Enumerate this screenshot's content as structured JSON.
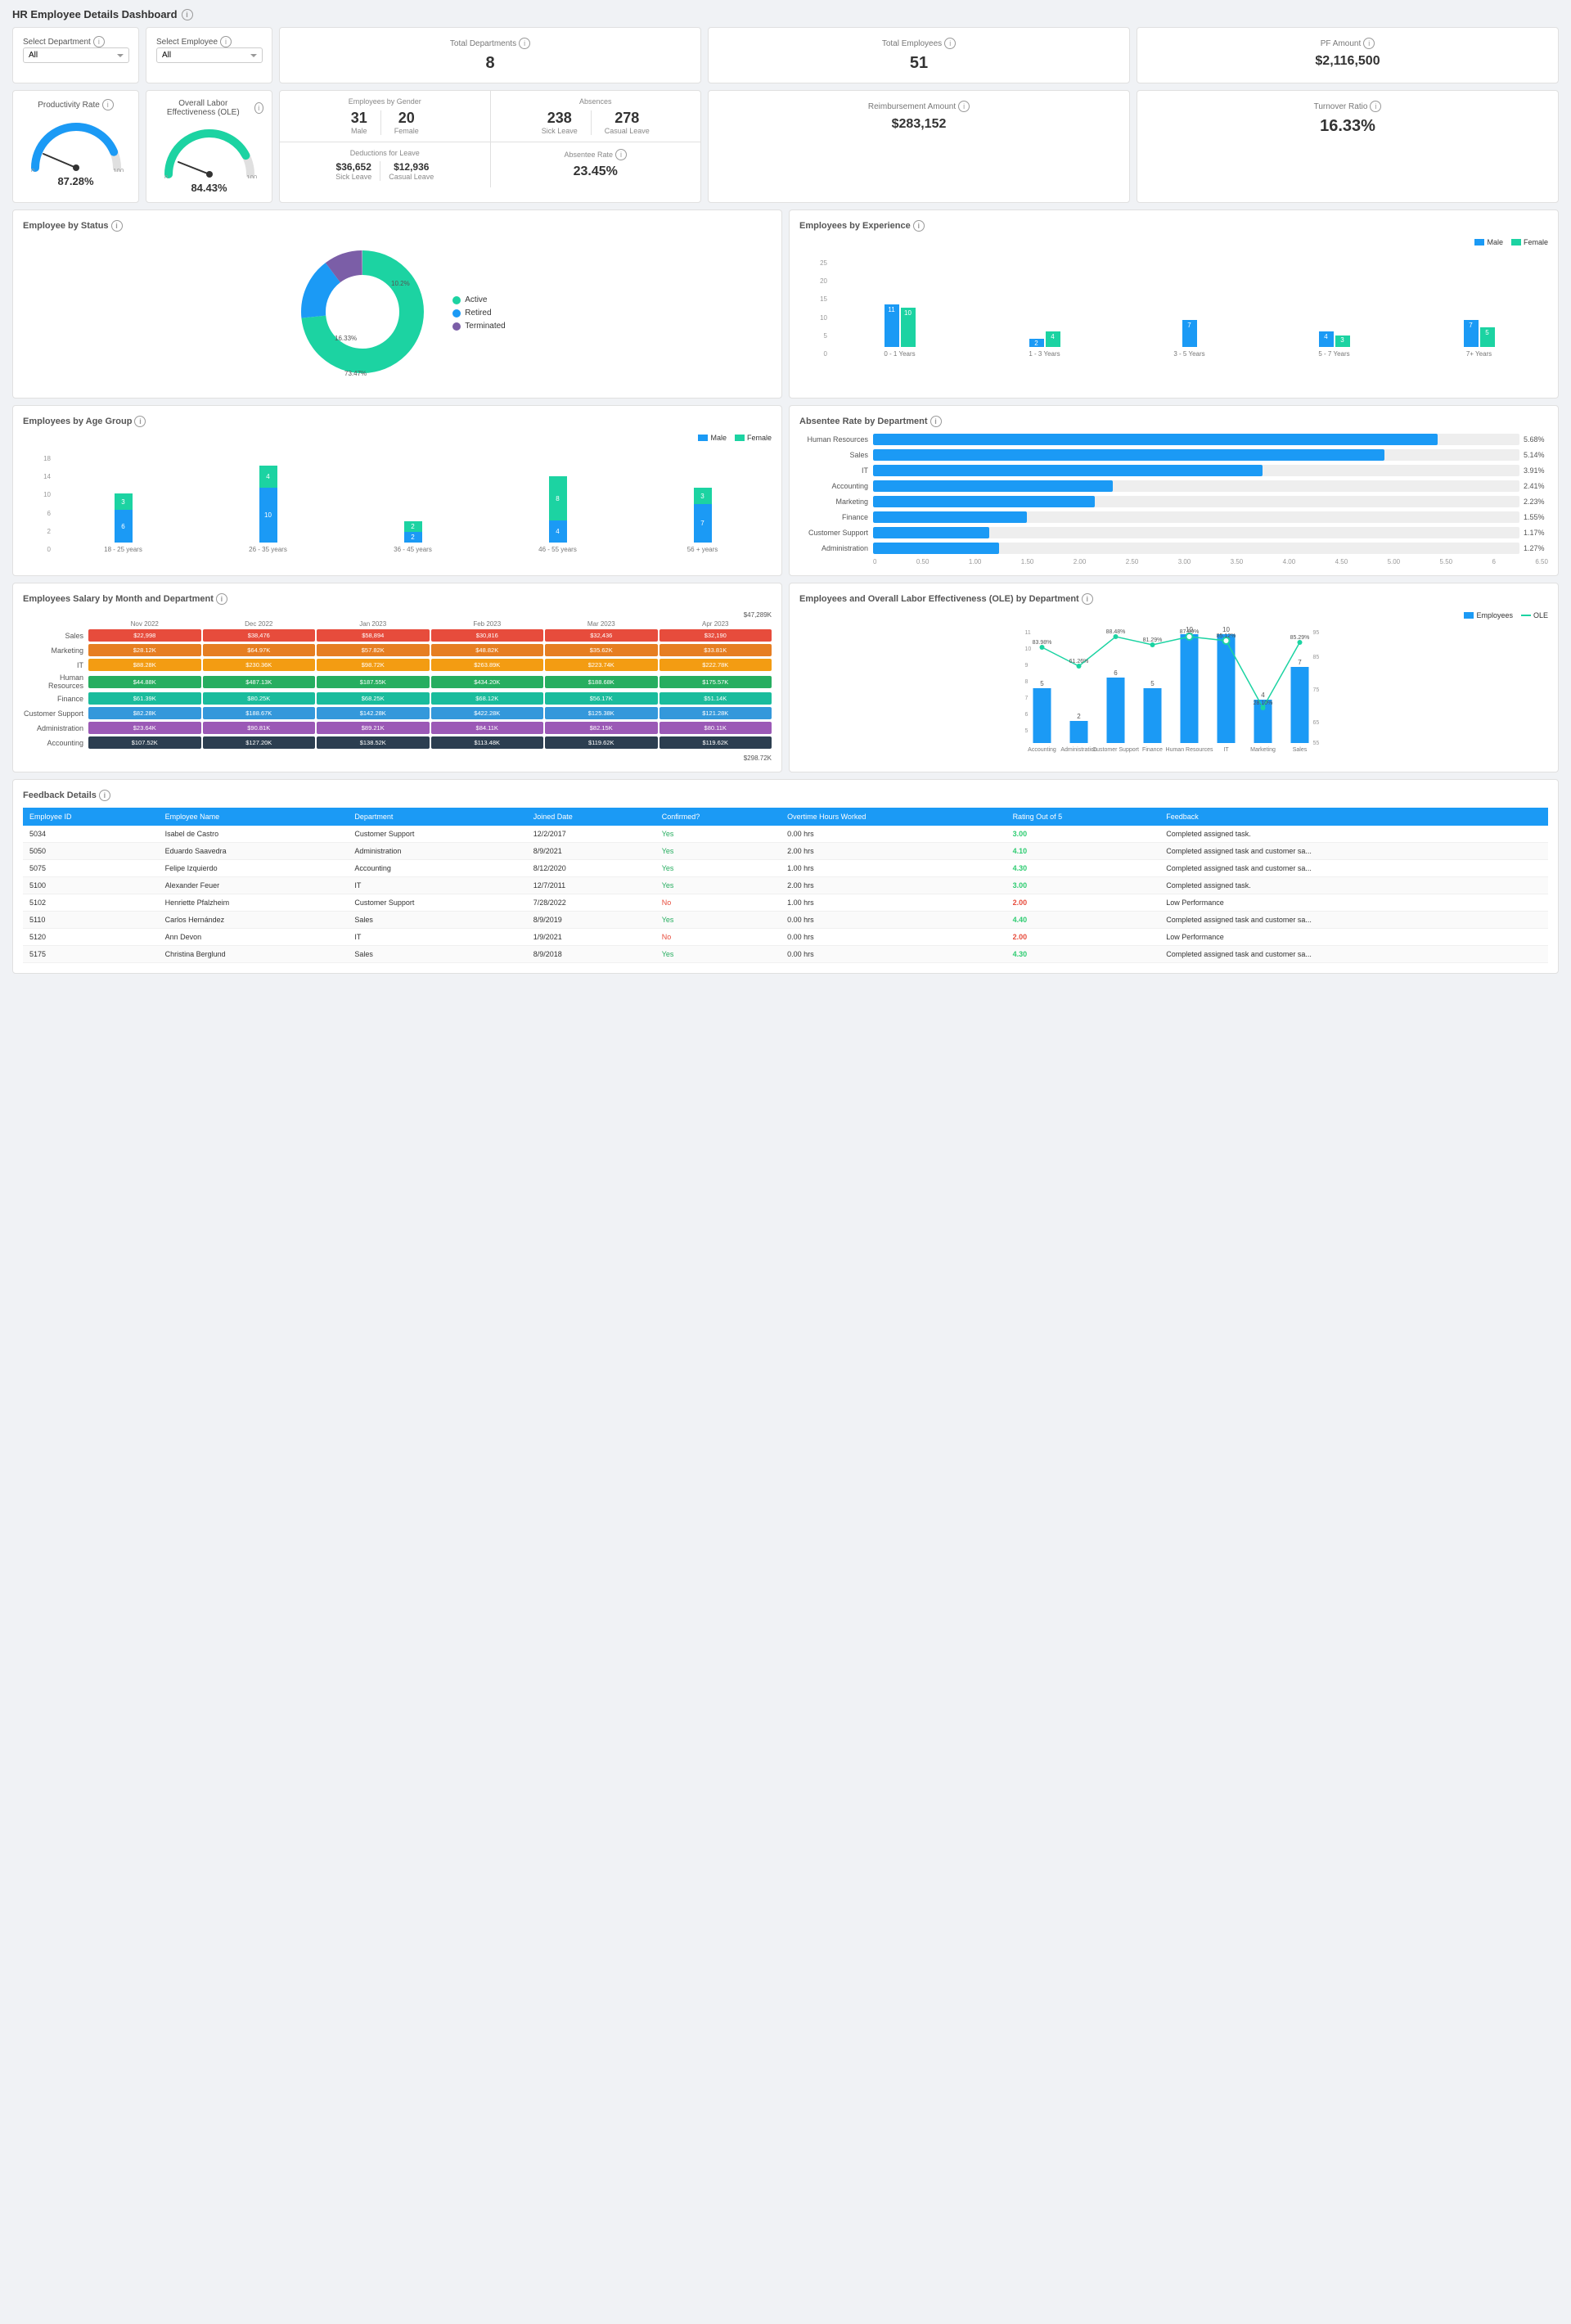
{
  "title": "HR Employee Details Dashboard",
  "filters": {
    "dept_label": "Select Department",
    "dept_value": "All",
    "emp_label": "Select Employee",
    "emp_value": "All"
  },
  "kpis": {
    "total_departments_label": "Total Departments",
    "total_departments_value": "8",
    "total_employees_label": "Total Employees",
    "total_employees_value": "51",
    "pf_amount_label": "PF Amount",
    "pf_amount_value": "$2,116,500"
  },
  "gauges": {
    "productivity_label": "Productivity Rate",
    "productivity_value": "87.28%",
    "ole_label": "Overall Labor Effectiveness (OLE)",
    "ole_value": "84.43%"
  },
  "gender": {
    "title": "Employees by Gender",
    "male_label": "Male",
    "male_value": "31",
    "female_label": "Female",
    "female_value": "20"
  },
  "absences": {
    "title": "Absences",
    "sick_leave_label": "Sick Leave",
    "sick_leave_value": "238",
    "casual_leave_label": "Casual Leave",
    "casual_leave_value": "278"
  },
  "reimbursement": {
    "label": "Reimbursement Amount",
    "value": "$283,152"
  },
  "deductions": {
    "title": "Deductions for Leave",
    "sick_amount": "$36,652",
    "sick_label": "Sick Leave",
    "casual_amount": "$12,936",
    "casual_label": "Casual Leave"
  },
  "absentee_rate": {
    "label": "Absentee Rate",
    "value": "23.45%"
  },
  "turnover": {
    "label": "Turnover Ratio",
    "value": "16.33%"
  },
  "employee_status": {
    "title": "Employee by Status",
    "active_label": "Active",
    "active_pct": "73.47%",
    "retired_label": "Retired",
    "retired_pct": "16.33%",
    "terminated_label": "Terminated",
    "terminated_pct": "10.2%",
    "active_color": "#1cd3a2",
    "retired_color": "#1b9af5",
    "terminated_color": "#7b5ea7"
  },
  "experience": {
    "title": "Employees by Experience",
    "male_label": "Male",
    "female_label": "Female",
    "groups": [
      {
        "label": "0 - 1 Years",
        "male": 11,
        "female": 10
      },
      {
        "label": "1 - 3 Years",
        "male": 2,
        "female": 4
      },
      {
        "label": "3 - 5 Years",
        "male": 7,
        "female": 0
      },
      {
        "label": "5 - 7 Years",
        "male": 4,
        "female": 3
      },
      {
        "label": "7+ Years",
        "male": 7,
        "female": 5
      }
    ]
  },
  "age_group": {
    "title": "Employees by Age Group",
    "male_label": "Male",
    "female_label": "Female",
    "groups": [
      {
        "label": "18 - 25 years",
        "male": 6,
        "female": 3
      },
      {
        "label": "26 - 35 years",
        "male": 10,
        "female": 4
      },
      {
        "label": "36 - 45 years",
        "male": 2,
        "female": 2
      },
      {
        "label": "46 - 55 years",
        "male": 4,
        "female": 8
      },
      {
        "label": "56 + years",
        "male": 7,
        "female": 3
      }
    ]
  },
  "absentee_dept": {
    "title": "Absentee Rate by Department",
    "depts": [
      {
        "name": "Human Resources",
        "value": 5.68,
        "max": 6.5
      },
      {
        "name": "Sales",
        "value": 5.14,
        "max": 6.5
      },
      {
        "name": "IT",
        "value": 3.91,
        "max": 6.5
      },
      {
        "name": "Accounting",
        "value": 2.41,
        "max": 6.5
      },
      {
        "name": "Marketing",
        "value": 2.23,
        "max": 6.5
      },
      {
        "name": "Finance",
        "value": 1.55,
        "max": 6.5
      },
      {
        "name": "Customer Support",
        "value": 1.17,
        "max": 6.5
      },
      {
        "name": "Administration",
        "value": 1.27,
        "max": 6.5
      }
    ]
  },
  "salary": {
    "title": "Employees Salary by Month and Department",
    "max_label": "$47,289K",
    "min_label": "$298.72K",
    "months": [
      "Nov 2022",
      "Dec 2022",
      "Jan 2023",
      "Feb 2023",
      "Mar 2023",
      "Apr 2023"
    ],
    "depts": [
      {
        "name": "Sales",
        "values": [
          "$22,998",
          "$38,476",
          "$58,894",
          "$30,816",
          "$32,436",
          "$32,190"
        ],
        "color": "#e74c3c"
      },
      {
        "name": "Marketing",
        "values": [
          "$28,12K",
          "$64,97K",
          "$57,82K",
          "$48,82K",
          "$35,62K",
          "$33,81K"
        ],
        "color": "#e67e22"
      },
      {
        "name": "IT",
        "values": [
          "$88,28K",
          "$230,36K",
          "$98,72K",
          "$263,89K",
          "$223,74K",
          "$222,78K"
        ],
        "color": "#f39c12"
      },
      {
        "name": "Human Resources",
        "values": [
          "$44,88K",
          "$487,13K",
          "$187,55K",
          "$434,20K",
          "$188,68K",
          "$175,57K"
        ],
        "color": "#27ae60"
      },
      {
        "name": "Finance",
        "values": [
          "$61,39K",
          "$80,25K",
          "$68,25K",
          "$68,12K",
          "$56,17K",
          "$51,14K"
        ],
        "color": "#1abc9c"
      },
      {
        "name": "Customer Support",
        "values": [
          "$82,28K",
          "$188,67K",
          "$142,28K",
          "$422,28K",
          "$125,38K",
          "$121,28K"
        ],
        "color": "#3498db"
      },
      {
        "name": "Administration",
        "values": [
          "$23,64K",
          "$90,81K",
          "$89,21K",
          "$84,11K",
          "$82,15K",
          "$80,11K"
        ],
        "color": "#9b59b6"
      },
      {
        "name": "Accounting",
        "values": [
          "$107,52K",
          "$127,20K",
          "$138,52K",
          "$113,48K",
          "$119,62K",
          "$119,62K"
        ],
        "color": "#2c3e50"
      }
    ]
  },
  "ole_dept": {
    "title": "Employees and Overall Labor Effectiveness (OLE) by Department",
    "emp_label": "Employees",
    "ole_label": "OLE",
    "depts": [
      {
        "name": "Accounting",
        "employees": 5,
        "ole": 83.98
      },
      {
        "name": "Administration",
        "employees": 2,
        "ole": 61.26
      },
      {
        "name": "Customer Support",
        "employees": 6,
        "ole": 88.48
      },
      {
        "name": "Finance",
        "employees": 5,
        "ole": 81.29
      },
      {
        "name": "Human Resources",
        "employees": 10,
        "ole": 87.89
      },
      {
        "name": "IT",
        "employees": 10,
        "ole": 85.12
      },
      {
        "name": "Marketing",
        "employees": 4,
        "ole": 28.1
      },
      {
        "name": "Sales",
        "employees": 7,
        "ole": 85.29
      }
    ]
  },
  "feedback": {
    "title": "Feedback Details",
    "columns": [
      "Employee ID",
      "Employee Name",
      "Department",
      "Joined Date",
      "Confirmed?",
      "Overtime Hours Worked",
      "Rating Out of 5",
      "Feedback"
    ],
    "rows": [
      {
        "id": "5034",
        "name": "Isabel de Castro",
        "dept": "Customer Support",
        "joined": "12/2/2017",
        "confirmed": "Yes",
        "overtime": "0.00 hrs",
        "rating": "3.00",
        "rating_color": "green",
        "feedback": "Completed assigned task."
      },
      {
        "id": "5050",
        "name": "Eduardo Saavedra",
        "dept": "Administration",
        "joined": "8/9/2021",
        "confirmed": "Yes",
        "overtime": "2.00 hrs",
        "rating": "4.10",
        "rating_color": "green",
        "feedback": "Completed assigned task and customer sa..."
      },
      {
        "id": "5075",
        "name": "Felipe Izquierdo",
        "dept": "Accounting",
        "joined": "8/12/2020",
        "confirmed": "Yes",
        "overtime": "1.00 hrs",
        "rating": "4.30",
        "rating_color": "green",
        "feedback": "Completed assigned task and customer sa..."
      },
      {
        "id": "5100",
        "name": "Alexander Feuer",
        "dept": "IT",
        "joined": "12/7/2011",
        "confirmed": "Yes",
        "overtime": "2.00 hrs",
        "rating": "3.00",
        "rating_color": "green",
        "feedback": "Completed assigned task."
      },
      {
        "id": "5102",
        "name": "Henriette Pfalzheim",
        "dept": "Customer Support",
        "joined": "7/28/2022",
        "confirmed": "No",
        "overtime": "1.00 hrs",
        "rating": "2.00",
        "rating_color": "red",
        "feedback": "Low Performance"
      },
      {
        "id": "5110",
        "name": "Carlos Hernández",
        "dept": "Sales",
        "joined": "8/9/2019",
        "confirmed": "Yes",
        "overtime": "0.00 hrs",
        "rating": "4.40",
        "rating_color": "green",
        "feedback": "Completed assigned task and customer sa..."
      },
      {
        "id": "5120",
        "name": "Ann Devon",
        "dept": "IT",
        "joined": "1/9/2021",
        "confirmed": "No",
        "overtime": "0.00 hrs",
        "rating": "2.00",
        "rating_color": "red",
        "feedback": "Low Performance"
      },
      {
        "id": "5175",
        "name": "Christina Berglund",
        "dept": "Sales",
        "joined": "8/9/2018",
        "confirmed": "Yes",
        "overtime": "0.00 hrs",
        "rating": "4.30",
        "rating_color": "green",
        "feedback": "Completed assigned task and customer sa..."
      }
    ]
  },
  "colors": {
    "blue": "#1b9af5",
    "teal": "#1cd3a2",
    "purple": "#7b5ea7",
    "accent": "#1b9af5"
  }
}
